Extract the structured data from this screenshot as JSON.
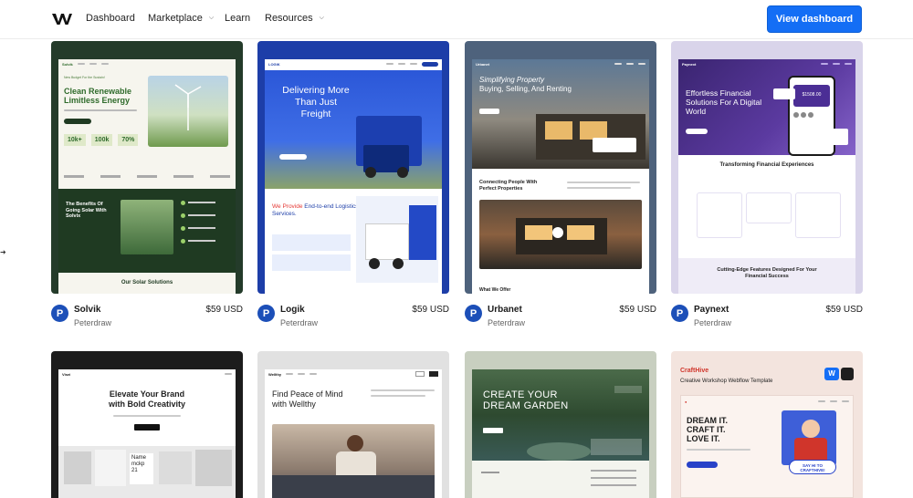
{
  "nav": {
    "items": [
      "Dashboard",
      "Marketplace",
      "Learn",
      "Resources"
    ],
    "cta": "View dashboard"
  },
  "templates": [
    {
      "name": "Solvik",
      "author": "Peterdraw",
      "price": "$59 USD",
      "brand": "Solvik",
      "tagline": "New Budget For the Sustain!",
      "headline1": "Clean Renewable",
      "headline2": "Limitless Energy",
      "stats": [
        "10k+",
        "100k",
        "70%"
      ],
      "section": "The Benefits Of Going Solar With Solvix",
      "footer": "Our Solar Solutions"
    },
    {
      "name": "Logik",
      "author": "Peterdraw",
      "price": "$59 USD",
      "brand": "LOGIK",
      "headline": "Delivering More Than Just Freight",
      "sub1": "We Provide",
      "sub2": "End-to-end Logistics Services."
    },
    {
      "name": "Urbanet",
      "author": "Peterdraw",
      "price": "$59 USD",
      "brand": "Urbanet",
      "headline1": "Simplifying Property",
      "headline2": "Buying, Selling, And Renting",
      "section": "Connecting People With Perfect Properties",
      "footer": "What We Offer"
    },
    {
      "name": "Paynext",
      "author": "Peterdraw",
      "price": "$59 USD",
      "brand": "Paynext",
      "headline": "Effortless Financial Solutions For A Digital World",
      "amount": "$1508.00",
      "section1": "Transforming Financial Experiences",
      "section2": "Cutting-Edge Features Designed For Your Financial Success"
    },
    {
      "brand": "Visei",
      "headline1": "Elevate Your Brand",
      "headline2": "with Bold Creativity",
      "tag1": "Name",
      "tag2": "mckp",
      "tag3": "21"
    },
    {
      "brand": "Wellthy",
      "headline1": "Find Peace of Mind",
      "headline2": "with Wellthy"
    },
    {
      "headline1": "CREATE YOUR",
      "headline2": "DREAM GARDEN"
    },
    {
      "brand": "CraftHive",
      "label": "Creative Workshop Webflow Template",
      "headline1": "DREAM IT.",
      "headline2": "CRAFT IT.",
      "headline3": "LOVE IT.",
      "bubble": "SAY HI TO CRAFTHIVE!"
    }
  ]
}
